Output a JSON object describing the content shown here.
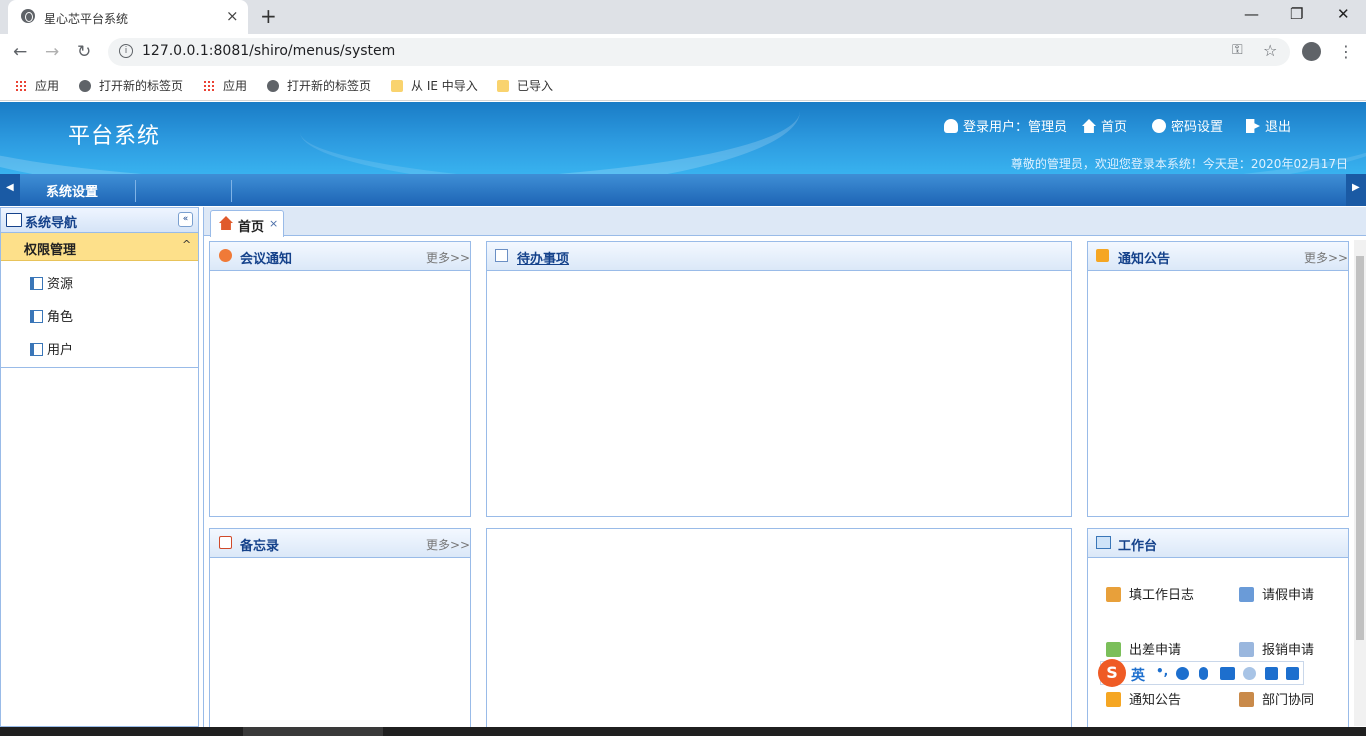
{
  "browser": {
    "tab_title": "星心芯平台系统",
    "tab_close": "×",
    "new_tab": "+",
    "url": "127.0.0.1:8081/shiro/menus/system",
    "minimize": "—",
    "maximize": "❐",
    "close": "✕",
    "back": "←",
    "forward": "→",
    "reload": "↻",
    "info": "i",
    "key": "⚿",
    "star": "☆",
    "kebab": "⋮",
    "bookmarks": [
      "应用",
      "打开新的标签页",
      "应用",
      "打开新的标签页",
      "从 IE 中导入",
      "已导入"
    ]
  },
  "header": {
    "logo": "平台系统",
    "login_user": "登录用户：管理员",
    "home": "首页",
    "password": "密码设置",
    "logout": "退出",
    "welcome": "尊敬的管理员，欢迎您登录本系统！今天是：2020年02月17日"
  },
  "menubar": {
    "left_arrow": "◀",
    "right_arrow": "▶",
    "item": "系统设置"
  },
  "sidebar": {
    "title": "系统导航",
    "collapse": "«",
    "group": "权限管理",
    "caret": "^",
    "items": [
      "资源",
      "角色",
      "用户"
    ]
  },
  "content": {
    "tab_label": "首页",
    "tab_close": "×"
  },
  "panels": {
    "meeting": {
      "title": "会议通知",
      "more": "更多>>"
    },
    "todo": {
      "title": "待办事项"
    },
    "notice": {
      "title": "通知公告",
      "more": "更多>>"
    },
    "memo": {
      "title": "备忘录",
      "more": "更多>>"
    },
    "workbench": {
      "title": "工作台",
      "items": [
        "填工作日志",
        "请假申请",
        "出差申请",
        "报销申请",
        "通知公告",
        "部门协同"
      ]
    }
  },
  "ime": {
    "logo": "S",
    "mode": "英",
    "punct": "•,"
  },
  "colors": {
    "header_blue": "#2d9be0",
    "menubar_blue": "#1d64b4",
    "panel_border": "#99bbe8",
    "title_blue": "#15428b",
    "group_yellow": "#fde08a"
  }
}
